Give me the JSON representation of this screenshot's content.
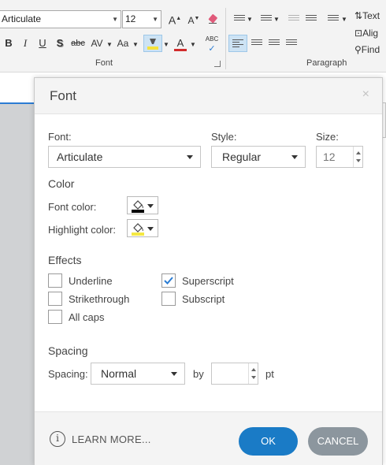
{
  "ribbon": {
    "font_name": "Articulate",
    "font_size": "12",
    "font_group_label": "Font",
    "paragraph_group_label": "Paragraph",
    "grow_font": "A",
    "shrink_font": "A",
    "bold": "B",
    "italic": "I",
    "underline": "U",
    "shadow": "S",
    "strikethrough": "abc",
    "char_spacing": "AV",
    "change_case": "Aa",
    "font_color": "A",
    "spell_check": "ABC",
    "text_direction": "Text",
    "align_text": "Alig",
    "find": "Find",
    "highlight_color": "#f5e23c",
    "font_color_bar": "#d12b2b"
  },
  "dialog": {
    "title": "Font",
    "close": "×",
    "font_label": "Font:",
    "font_value": "Articulate",
    "style_label": "Style:",
    "style_value": "Regular",
    "size_label": "Size:",
    "size_value": "12",
    "color_section": "Color",
    "font_color_label": "Font color:",
    "highlight_color_label": "Highlight color:",
    "font_color_swatch": "#000000",
    "highlight_color_swatch": "#f4e842",
    "effects_section": "Effects",
    "effects": {
      "underline": "Underline",
      "strikethrough": "Strikethrough",
      "all_caps": "All caps",
      "superscript": "Superscript",
      "subscript": "Subscript"
    },
    "spacing_section": "Spacing",
    "spacing_label": "Spacing:",
    "spacing_value": "Normal",
    "by_label": "by",
    "by_value": "",
    "pt_label": "pt",
    "learn_more_icon": "i",
    "learn_more": "LEARN MORE...",
    "ok": "OK",
    "cancel": "CANCEL",
    "check_color": "#2b7cd3"
  }
}
